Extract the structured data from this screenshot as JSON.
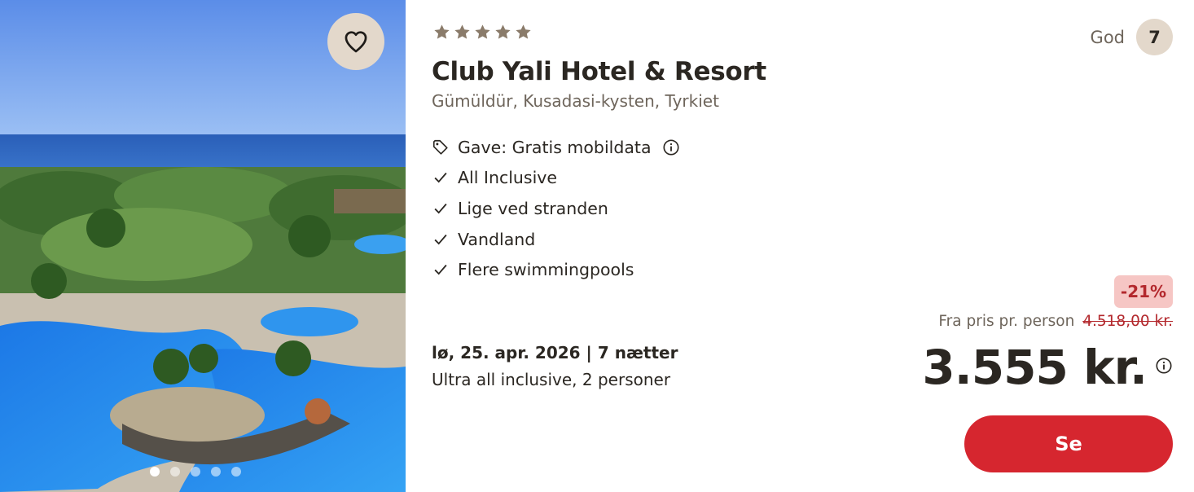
{
  "hotel": {
    "stars": 5,
    "name": "Club Yali Hotel & Resort",
    "location": "Gümüldür, Kusadasi-kysten, Tyrkiet"
  },
  "gallery": {
    "image_count": 5,
    "active_index": 0,
    "favorite_icon": "heart-outline-icon"
  },
  "features": [
    {
      "icon": "tag-icon",
      "label": "Gave: Gratis mobildata",
      "has_info": true
    },
    {
      "icon": "check-icon",
      "label": "All Inclusive"
    },
    {
      "icon": "check-icon",
      "label": "Lige ved stranden"
    },
    {
      "icon": "check-icon",
      "label": "Vandland"
    },
    {
      "icon": "check-icon",
      "label": "Flere swimmingpools"
    }
  ],
  "trip": {
    "date_line": "lø, 25. apr. 2026 | 7 nætter",
    "board_line": "Ultra all inclusive, 2 personer"
  },
  "rating": {
    "label": "God",
    "score": "7"
  },
  "price": {
    "discount": "-21%",
    "from_label": "Fra pris pr. person",
    "old_price": "4.518,00 kr.",
    "current": "3.555 kr."
  },
  "cta": {
    "label": "Se"
  },
  "colors": {
    "accent": "#d6262f",
    "badge_bg": "#e3d8cb",
    "discount_bg": "#f6c6c4",
    "discount_text": "#b3282d",
    "muted_text": "#6e655b",
    "star": "#8a7b6a"
  }
}
